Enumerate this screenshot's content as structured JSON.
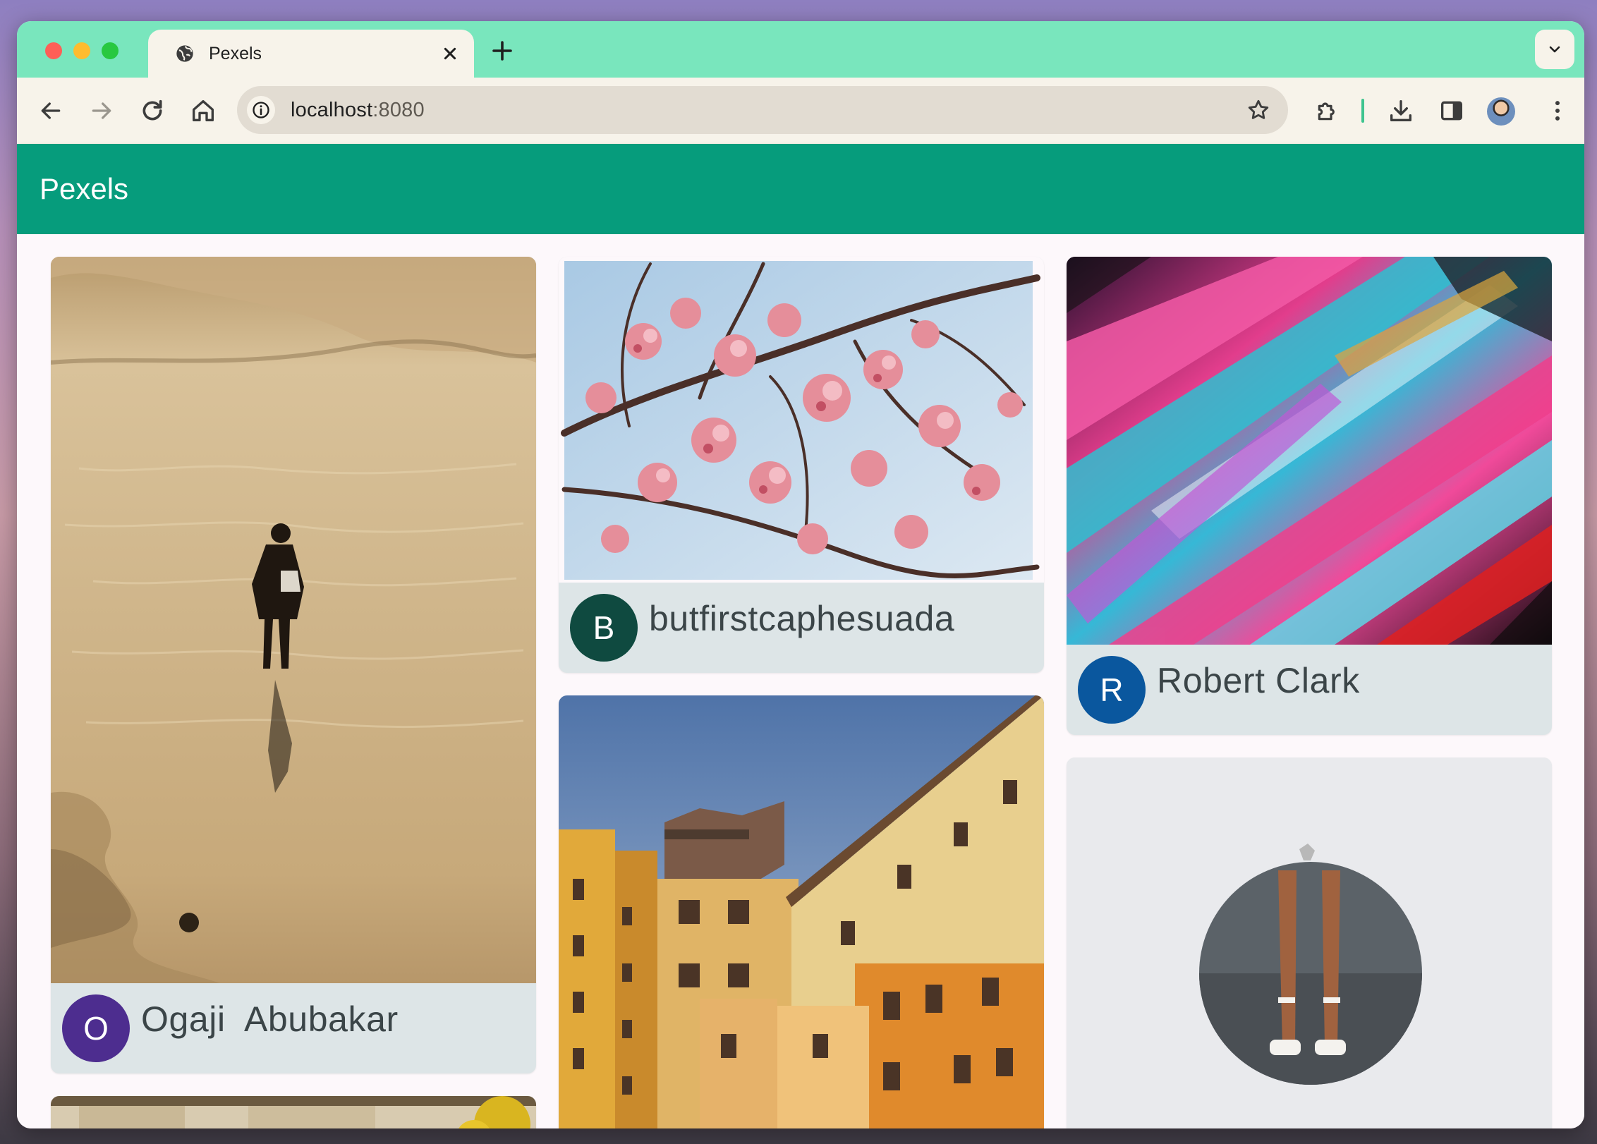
{
  "browser": {
    "tab_title": "Pexels",
    "url_host": "localhost",
    "url_port": ":8080",
    "icons": {
      "tab": "globe-icon",
      "close": "close-icon",
      "new_tab": "plus-icon",
      "tab_search": "chevron-down-icon",
      "back": "arrow-left-icon",
      "forward": "arrow-right-icon",
      "reload": "reload-icon",
      "home": "home-icon",
      "site_info": "info-icon",
      "bookmark": "star-icon",
      "extensions": "puzzle-icon",
      "downloads": "download-icon",
      "side_panel": "side-panel-icon",
      "profile": "avatar",
      "menu": "kebab-menu-icon"
    },
    "colors": {
      "tab_strip": "#79e6bd",
      "toolbar": "#f7f3ea"
    }
  },
  "app": {
    "title": "Pexels",
    "colors": {
      "app_bar": "#069c7c",
      "card": "#dde5e7"
    }
  },
  "photos": [
    {
      "initial": "O",
      "author": "Ogaji  Abubakar",
      "avatar_color": "#4d2d8f"
    },
    {
      "initial": "B",
      "author": "butfirstcaphesuada",
      "avatar_color": "#0f4a40"
    },
    {
      "initial": "R",
      "author": "Robert Clark",
      "avatar_color": "#0a579e"
    }
  ]
}
